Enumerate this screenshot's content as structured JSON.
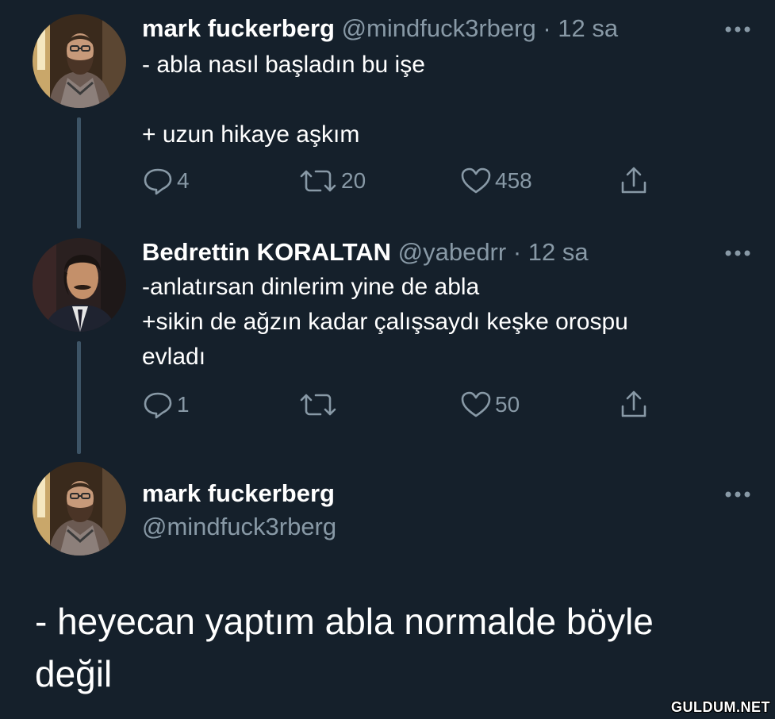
{
  "tweets": [
    {
      "name": "mark fuckerberg",
      "handle": "@mindfuck3rberg",
      "separator": "·",
      "time": "12 sa",
      "lines": [
        "- abla nasıl başladın bu işe",
        "",
        "+ uzun hikaye aşkım"
      ],
      "replies": "4",
      "retweets": "20",
      "likes": "458"
    },
    {
      "name": "Bedrettin KORALTAN",
      "handle": "@yabedrr",
      "separator": "·",
      "time": "12 sa",
      "lines": [
        "-anlatırsan dinlerim yine de abla",
        "+sikin de ağzın kadar çalışsaydı keşke orospu",
        "evladı"
      ],
      "replies": "1",
      "retweets": "",
      "likes": "50"
    },
    {
      "name": "mark fuckerberg",
      "handle": "@mindfuck3rberg",
      "text_lines": [
        "- heyecan yaptım abla normalde böyle",
        "değil"
      ]
    }
  ],
  "icons": {
    "reply": "reply-icon",
    "retweet": "retweet-icon",
    "like": "heart-icon",
    "share": "share-icon",
    "more": "more-icon"
  },
  "colors": {
    "background": "#15202b",
    "text": "#ffffff",
    "secondary": "#8899a6",
    "thread_line": "#3d5466"
  },
  "watermark": "GULDUM.NET"
}
